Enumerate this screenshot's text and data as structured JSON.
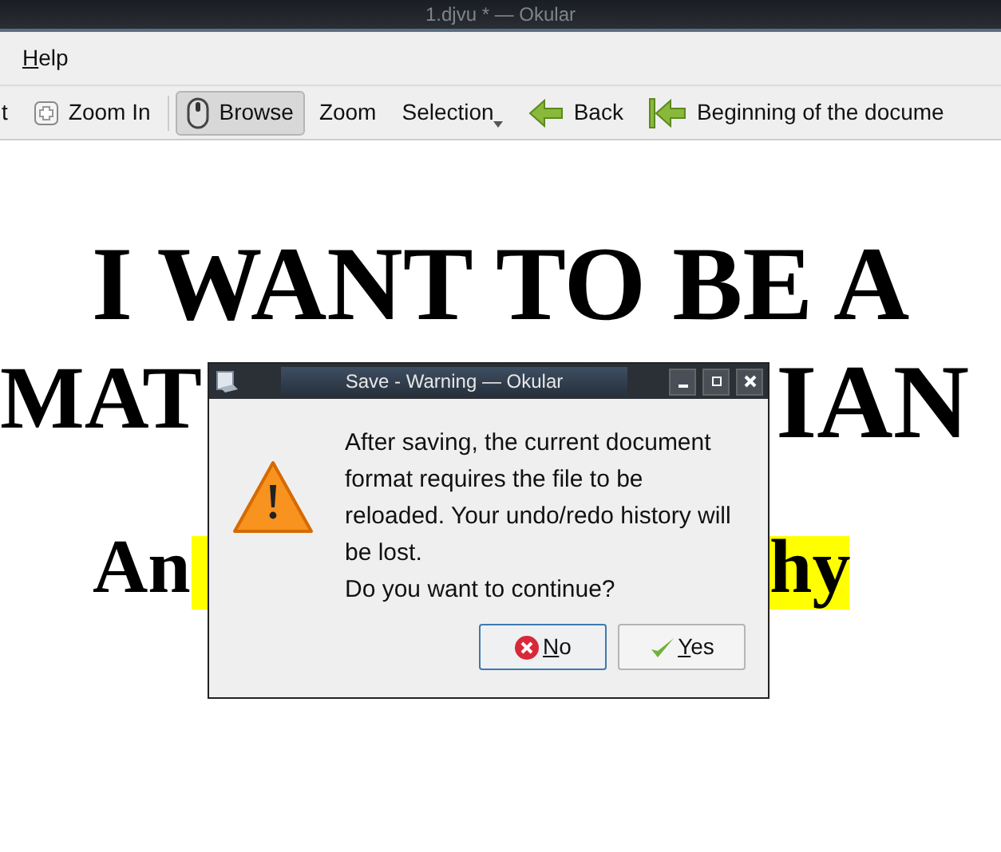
{
  "window": {
    "title": "1.djvu * — Okular"
  },
  "menu": [
    {
      "label": "Help"
    }
  ],
  "toolbar": [
    {
      "kind": "text",
      "label": "t",
      "selected": false
    },
    {
      "kind": "zoomin",
      "label": "Zoom In",
      "selected": false
    },
    {
      "kind": "separator"
    },
    {
      "kind": "browse",
      "label": "Browse",
      "selected": true
    },
    {
      "kind": "text",
      "label": "Zoom",
      "selected": false
    },
    {
      "kind": "dropdown",
      "label": "Selection",
      "selected": false
    },
    {
      "kind": "back",
      "label": "Back",
      "selected": false
    },
    {
      "kind": "begin",
      "label": "Beginning of the docume",
      "selected": false
    }
  ],
  "document": {
    "lines": [
      {
        "kind": "title",
        "text": "I WANT TO BE A"
      },
      {
        "kind": "left",
        "text": "MAT"
      },
      {
        "kind": "right",
        "text": "IAN"
      },
      {
        "kind": "subleft",
        "text": "An"
      },
      {
        "kind": "subright",
        "text": "hy",
        "highlighted": true
      }
    ]
  },
  "dialog": {
    "title": "Save - Warning — Okular",
    "message": [
      "After saving, the current document format requires the file to be reloaded. Your undo/redo history will be lost.",
      "Do you want to continue?"
    ],
    "buttons": [
      {
        "kind": "no",
        "label": "No",
        "selected": true
      },
      {
        "kind": "yes",
        "label": "Yes",
        "selected": false
      }
    ]
  }
}
